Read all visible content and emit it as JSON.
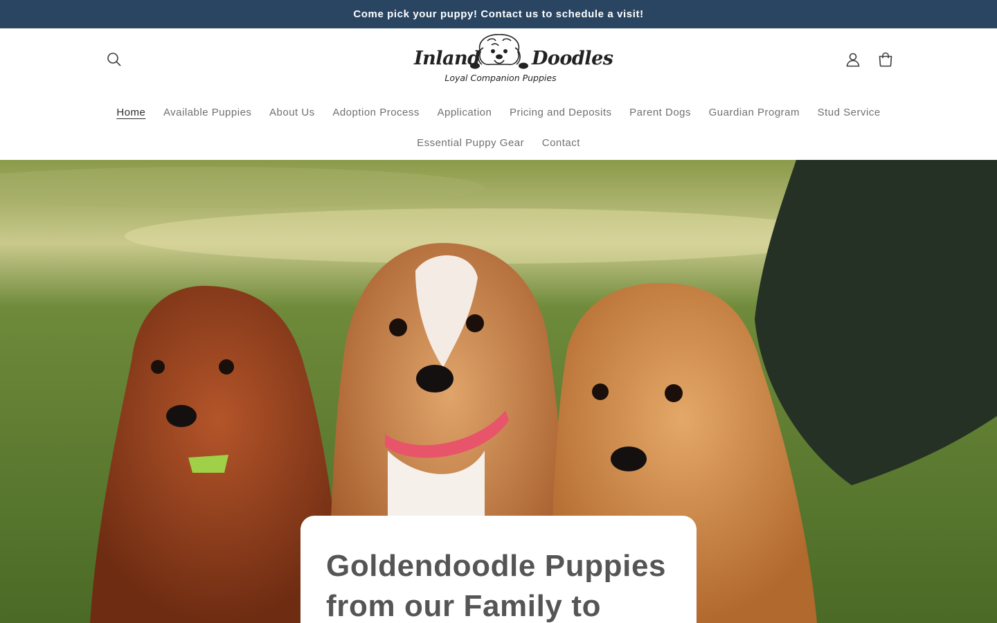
{
  "announcement": {
    "text": "Come pick your puppy! Contact us to schedule a visit!"
  },
  "header": {
    "logo": {
      "word_left": "Inland",
      "word_right": "Doodles",
      "tagline": "Loyal Companion Puppies"
    },
    "icons": {
      "search": "search-icon",
      "account": "account-icon",
      "cart": "cart-icon"
    }
  },
  "nav": {
    "row1": [
      "Home",
      "Available Puppies",
      "About Us",
      "Adoption Process",
      "Application",
      "Pricing and Deposits",
      "Parent Dogs",
      "Guardian Program",
      "Stud Service"
    ],
    "row2": [
      "Essential Puppy Gear",
      "Contact"
    ],
    "active": "Home"
  },
  "hero": {
    "title_line1": "Goldendoodle Puppies",
    "title_line2": "from our Family to"
  },
  "colors": {
    "announcement_bg": "#294562",
    "announcement_text": "#ffffff",
    "nav_text": "#6f6f6f",
    "heading_text": "#555555"
  }
}
